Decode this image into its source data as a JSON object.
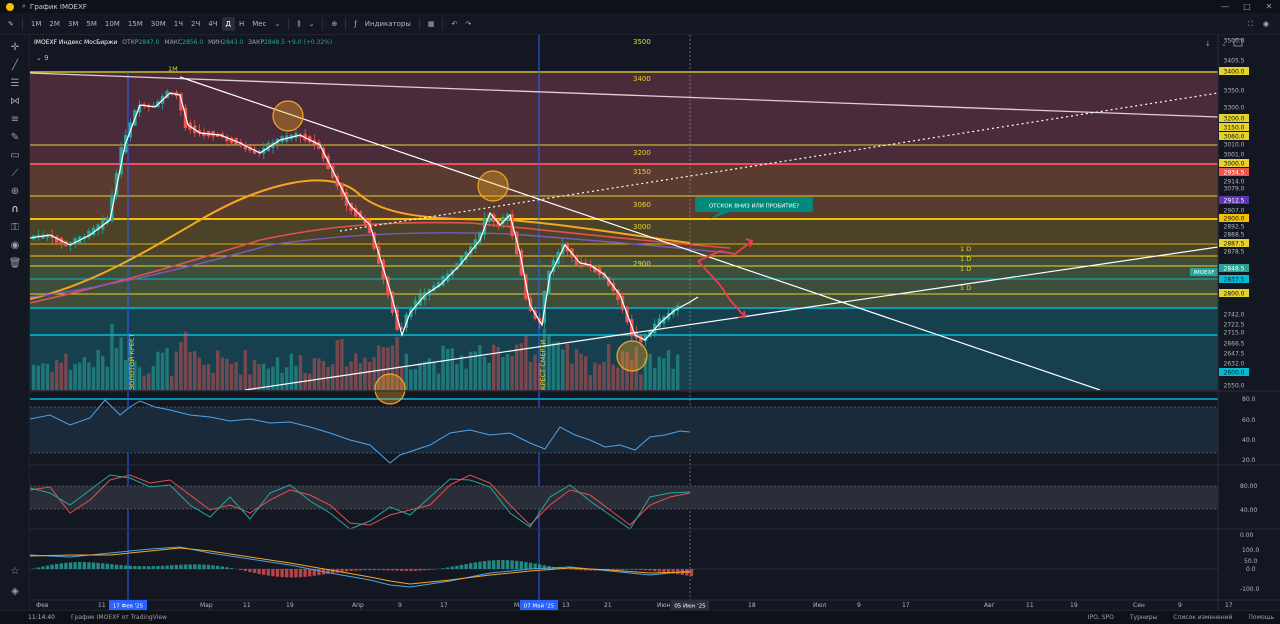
{
  "window": {
    "title": "График IMOEXF"
  },
  "toolbar": {
    "timeframes": [
      "1М",
      "2М",
      "3М",
      "5М",
      "10М",
      "15М",
      "30М",
      "1Ч",
      "2Ч",
      "4Ч",
      "Д",
      "Н",
      "Мес"
    ],
    "active_timeframe": "Д",
    "indicators_label": "Индикаторы"
  },
  "legend": {
    "symbol": "IMOEXF Индекс МосБиржи",
    "open_label": "ОТКР",
    "open": "2847.0",
    "high_label": "МАКС",
    "high": "2856.0",
    "low_label": "МИН",
    "low": "2843.0",
    "close_label": "ЗАКР",
    "close": "2848.5",
    "change": "+9.0 (+0.32%)",
    "indicator_count": "9"
  },
  "price_axis": [
    "3500.0",
    "3405.5",
    "3400.0",
    "3350.0",
    "3300.0",
    "3200.0",
    "3150.0",
    "3060.0",
    "3010.0",
    "3001.0",
    "3000.0",
    "2934.5",
    "2914.0",
    "3079.0",
    "2912.5",
    "2907.0",
    "2900.0",
    "2892.5",
    "2888.5",
    "2887.5",
    "2878.5",
    "2848.5",
    "2837.5",
    "2800.0",
    "2742.0",
    "2722.5",
    "2715.0",
    "2666.5",
    "2647.5",
    "2632.0",
    "2600.0",
    "2550.0"
  ],
  "level_labels": [
    "3500",
    "3400",
    "3200",
    "3150",
    "3060",
    "3000",
    "2900"
  ],
  "tf_labels": [
    "1М",
    "1 D",
    "1 D",
    "1 D",
    "1 D"
  ],
  "callout": "ОТСКОК ВНИЗ ИЛИ ПРОБИТИЕ?",
  "vertical_notes": [
    "ЗОЛОТОЙ КРЕСТ",
    "КРЕСТ СМЕРТИ"
  ],
  "rsi_axis": [
    "80.0",
    "60.0",
    "40.0",
    "20.0"
  ],
  "stoch_axis": [
    "80.00",
    "40.00",
    "0.00"
  ],
  "macd_axis": [
    "100.0",
    "50.0",
    "0.0",
    "-100.0"
  ],
  "time_axis": [
    "Фев",
    "11",
    "Мар",
    "11",
    "19",
    "Апр",
    "9",
    "17",
    "Ма",
    "13",
    "21",
    "Июн",
    "18",
    "Июл",
    "9",
    "17",
    "Авг",
    "11",
    "19",
    "Сен",
    "9",
    "17"
  ],
  "time_badges": [
    "17 Фев '25",
    "07 Май '25",
    "05 Июн '25"
  ],
  "symbol_badge": "IMOEXF",
  "status": {
    "clock": "11:14:40",
    "chart_caption": "График IMOEXF от TradingView",
    "ipo": "IPO, SPO",
    "tournaments": "Турниры",
    "changes": "Список изменений",
    "help": "Помощь"
  },
  "colors": {
    "background": "#131722",
    "up": "#26a69a",
    "down": "#ef5350",
    "level_yellow": "#e6d22c",
    "cyan": "#00bcd4",
    "callout": "#00897b"
  }
}
